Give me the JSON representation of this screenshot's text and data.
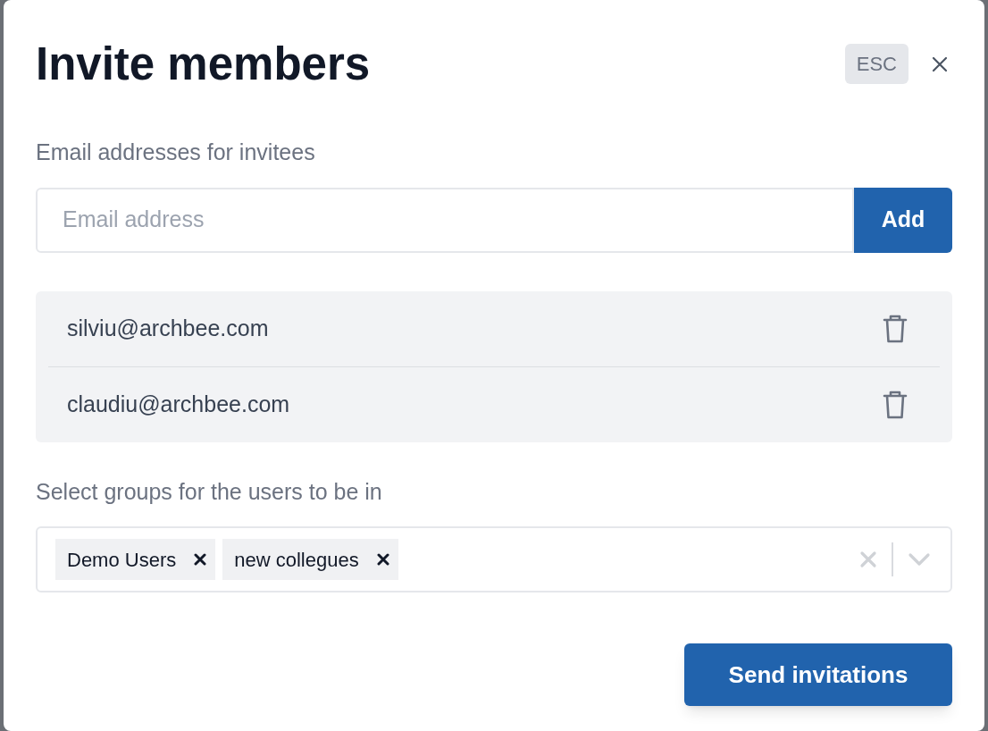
{
  "dialog": {
    "title": "Invite members",
    "esc_hint": "ESC"
  },
  "email_section": {
    "label": "Email addresses for invitees",
    "placeholder": "Email address",
    "add_button": "Add"
  },
  "invitees": [
    {
      "email": "silviu@archbee.com"
    },
    {
      "email": "claudiu@archbee.com"
    }
  ],
  "groups_section": {
    "label": "Select groups for the users to be in",
    "selected_groups": [
      {
        "name": "Demo Users"
      },
      {
        "name": "new collegues"
      }
    ]
  },
  "submit_button": "Send invitations"
}
